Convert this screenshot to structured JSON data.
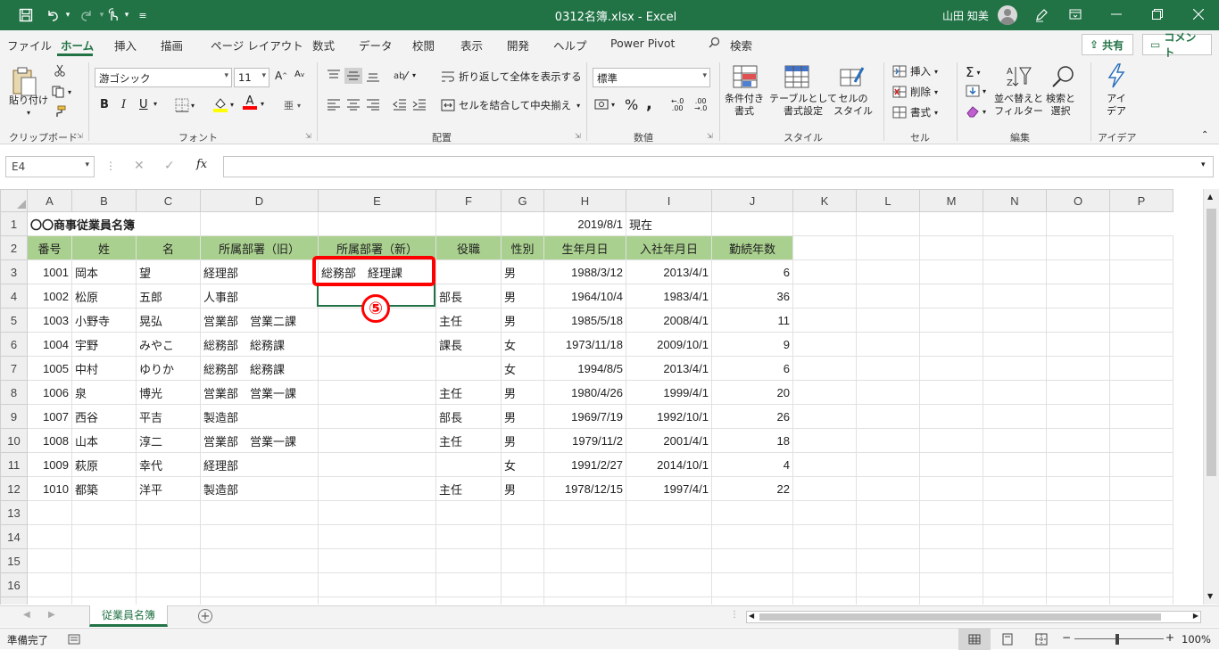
{
  "window": {
    "title": "0312名簿.xlsx  -  Excel",
    "user": "山田 知美"
  },
  "menu": {
    "tabs": [
      "ファイル",
      "ホーム",
      "挿入",
      "描画",
      "ページ レイアウト",
      "数式",
      "データ",
      "校閲",
      "表示",
      "開発",
      "ヘルプ",
      "Power Pivot"
    ],
    "search": "検索",
    "share": "共有",
    "comment": "コメント"
  },
  "ribbon": {
    "clipboard": {
      "label": "クリップボード",
      "paste": "貼り付け"
    },
    "font": {
      "label": "フォント",
      "name": "游ゴシック",
      "size": "11"
    },
    "alignment": {
      "label": "配置",
      "wrap": "折り返して全体を表示する",
      "merge": "セルを結合して中央揃え"
    },
    "number": {
      "label": "数値",
      "format": "標準"
    },
    "styles": {
      "label": "スタイル",
      "conditional": "条件付き\n書式",
      "table": "テーブルとして\n書式設定",
      "cell": "セルの\nスタイル"
    },
    "cells": {
      "label": "セル",
      "insert": "挿入",
      "delete": "削除",
      "format": "書式"
    },
    "editing": {
      "label": "編集",
      "sort": "並べ替えと\nフィルター",
      "find": "検索と\n選択"
    },
    "ideas": {
      "label": "アイデア",
      "button": "アイ\nデア"
    }
  },
  "formula_bar": {
    "name_box": "E4",
    "content": ""
  },
  "columns": [
    "A",
    "B",
    "C",
    "D",
    "E",
    "F",
    "G",
    "H",
    "I",
    "J",
    "K",
    "L",
    "M",
    "N",
    "O",
    "P"
  ],
  "sheet": {
    "title": "〇〇商事従業員名簿",
    "date": "2019/8/1",
    "date_suffix": "現在",
    "headers": [
      "番号",
      "姓",
      "名",
      "所属部署（旧）",
      "所属部署（新）",
      "役職",
      "性別",
      "生年月日",
      "入社年月日",
      "勤続年数"
    ],
    "rows": [
      [
        "1001",
        "岡本",
        "望",
        "経理部",
        "総務部　経理課",
        "",
        "男",
        "1988/3/12",
        "2013/4/1",
        "6"
      ],
      [
        "1002",
        "松原",
        "五郎",
        "人事部",
        "",
        "部長",
        "男",
        "1964/10/4",
        "1983/4/1",
        "36"
      ],
      [
        "1003",
        "小野寺",
        "晃弘",
        "営業部　営業二課",
        "",
        "主任",
        "男",
        "1985/5/18",
        "2008/4/1",
        "11"
      ],
      [
        "1004",
        "宇野",
        "みやこ",
        "総務部　総務課",
        "",
        "課長",
        "女",
        "1973/11/18",
        "2009/10/1",
        "9"
      ],
      [
        "1005",
        "中村",
        "ゆりか",
        "総務部　総務課",
        "",
        "",
        "女",
        "1994/8/5",
        "2013/4/1",
        "6"
      ],
      [
        "1006",
        "泉",
        "博光",
        "営業部　営業一課",
        "",
        "主任",
        "男",
        "1980/4/26",
        "1999/4/1",
        "20"
      ],
      [
        "1007",
        "西谷",
        "平吉",
        "製造部",
        "",
        "部長",
        "男",
        "1969/7/19",
        "1992/10/1",
        "26"
      ],
      [
        "1008",
        "山本",
        "淳二",
        "営業部　営業一課",
        "",
        "主任",
        "男",
        "1979/11/2",
        "2001/4/1",
        "18"
      ],
      [
        "1009",
        "萩原",
        "幸代",
        "経理部",
        "",
        "",
        "女",
        "1991/2/27",
        "2014/10/1",
        "4"
      ],
      [
        "1010",
        "都築",
        "洋平",
        "製造部",
        "",
        "主任",
        "男",
        "1978/12/15",
        "1997/4/1",
        "22"
      ]
    ]
  },
  "annotation": {
    "step": "⑤"
  },
  "sheet_tab": "従業員名簿",
  "status": {
    "ready": "準備完了",
    "zoom": "100%"
  }
}
